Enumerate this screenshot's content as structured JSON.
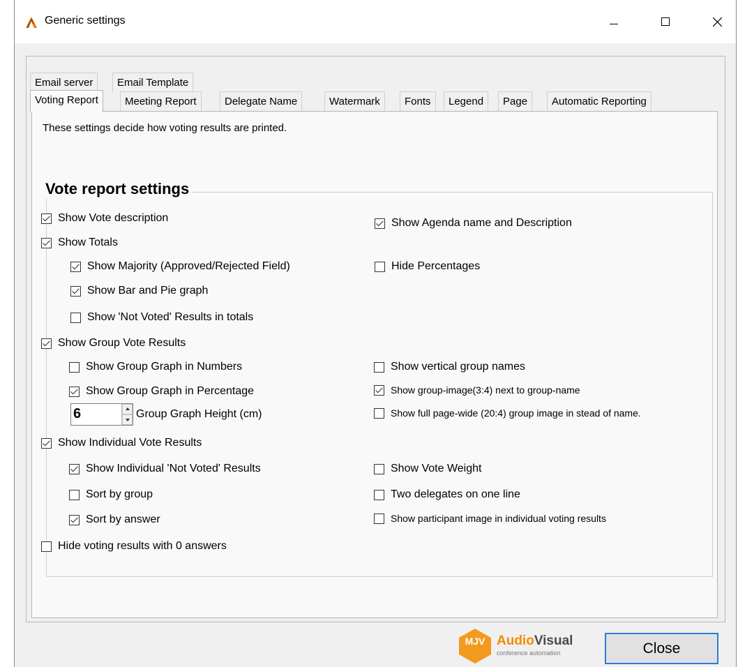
{
  "window": {
    "title": "Generic settings",
    "minimize_symbol": "—",
    "maximize_symbol": "☐",
    "close_symbol": "✕"
  },
  "tabs_row1": [
    "Email server",
    "Email Template"
  ],
  "tabs_row2": [
    "Voting Report",
    "Meeting Report",
    "Delegate Name",
    "Watermark",
    "Fonts",
    "Legend",
    "Page",
    "Automatic Reporting"
  ],
  "active_tab": "Voting Report",
  "intro_text": "These settings decide how voting results are printed.",
  "group_title": "Vote report settings",
  "checkboxes": {
    "show_vote_description": {
      "label": "Show Vote description",
      "checked": true
    },
    "show_totals": {
      "label": "Show Totals",
      "checked": true
    },
    "show_majority": {
      "label": "Show Majority (Approved/Rejected Field)",
      "checked": true
    },
    "show_bar_pie": {
      "label": "Show Bar and Pie graph",
      "checked": true
    },
    "show_not_voted_totals": {
      "label": "Show 'Not Voted' Results in totals",
      "checked": false
    },
    "show_group_vote_results": {
      "label": "Show Group Vote Results",
      "checked": true
    },
    "show_group_graph_numbers": {
      "label": "Show Group Graph in Numbers",
      "checked": false
    },
    "show_group_graph_percentage": {
      "label": "Show Group Graph in Percentage",
      "checked": true
    },
    "show_individual_vote_results": {
      "label": "Show Individual Vote Results",
      "checked": true
    },
    "show_individual_not_voted": {
      "label": "Show Individual 'Not Voted' Results",
      "checked": true
    },
    "sort_by_group": {
      "label": "Sort by group",
      "checked": false
    },
    "sort_by_answer": {
      "label": "Sort by answer",
      "checked": true
    },
    "hide_zero_answers": {
      "label": "Hide voting results with 0 answers",
      "checked": false
    },
    "show_agenda_name": {
      "label": "Show Agenda name and Description",
      "checked": true
    },
    "hide_percentages": {
      "label": "Hide Percentages",
      "checked": false
    },
    "show_vertical_group_names": {
      "label": "Show vertical group names",
      "checked": false
    },
    "show_group_image": {
      "label": "Show group-image(3:4)  next to group-name",
      "checked": true
    },
    "show_full_page_group_image": {
      "label": "Show full page-wide (20:4) group image in stead of name.",
      "checked": false
    },
    "show_vote_weight": {
      "label": "Show Vote Weight",
      "checked": false
    },
    "two_delegates_one_line": {
      "label": "Two delegates on one line",
      "checked": false
    },
    "show_participant_image": {
      "label": "Show participant image in individual voting results",
      "checked": false
    }
  },
  "group_graph_height": {
    "value": "6",
    "label": "Group Graph Height (cm)"
  },
  "logo": {
    "mark": "MJV",
    "brand_part1": "Audio",
    "brand_part2": "Visual",
    "tagline": "conference automation"
  },
  "close_button": "Close"
}
